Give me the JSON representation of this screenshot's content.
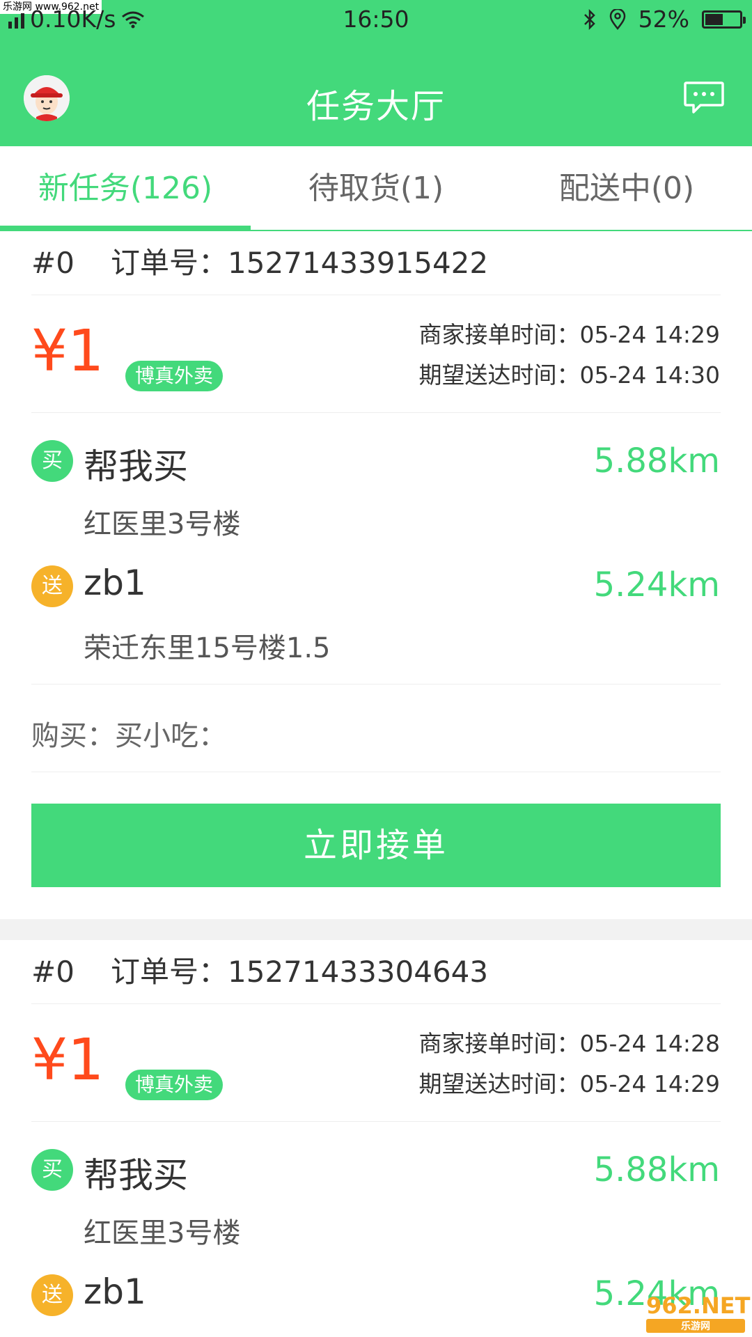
{
  "status_bar": {
    "watermark": "乐游网 www.962.net",
    "network": "0.10K/s",
    "time": "16:50",
    "battery": "52%",
    "battery_level": 0.52
  },
  "header": {
    "title": "任务大厅",
    "avatar_icon": "avatar-icon",
    "message_icon": "message-icon"
  },
  "tabs": [
    {
      "label": "新任务(126)",
      "active": true
    },
    {
      "label": "待取货(1)",
      "active": false
    },
    {
      "label": "配送中(0)",
      "active": false
    }
  ],
  "orders": [
    {
      "index": "#0",
      "order_label": "订单号：",
      "order_no": "15271433915422",
      "price": "¥1",
      "tag": "博真外卖",
      "merchant_time_label": "商家接单时间：",
      "merchant_time": "05-24 14:29",
      "expected_time_label": "期望送达时间：",
      "expected_time": "05-24 14:30",
      "pickup": {
        "badge": "买",
        "name": "帮我买",
        "distance": "5.88km",
        "address": "红医里3号楼"
      },
      "dropoff": {
        "badge": "送",
        "name": "zb1",
        "distance": "5.24km",
        "address": "荣迁东里15号楼1.5"
      },
      "purchase": "购买：买小吃：",
      "accept_label": "立即接单"
    },
    {
      "index": "#0",
      "order_label": "订单号：",
      "order_no": "15271433304643",
      "price": "¥1",
      "tag": "博真外卖",
      "merchant_time_label": "商家接单时间：",
      "merchant_time": "05-24 14:28",
      "expected_time_label": "期望送达时间：",
      "expected_time": "05-24 14:29",
      "pickup": {
        "badge": "买",
        "name": "帮我买",
        "distance": "5.88km",
        "address": "红医里3号楼"
      },
      "dropoff": {
        "badge": "送",
        "name": "zb1",
        "distance": "5.24km",
        "address": ""
      }
    }
  ],
  "watermark_bottom": {
    "main": "962.NET",
    "sub": "乐游网"
  },
  "colors": {
    "brand_green": "#43d97b",
    "price_red": "#ff4a1c",
    "send_orange": "#f6b22a"
  }
}
